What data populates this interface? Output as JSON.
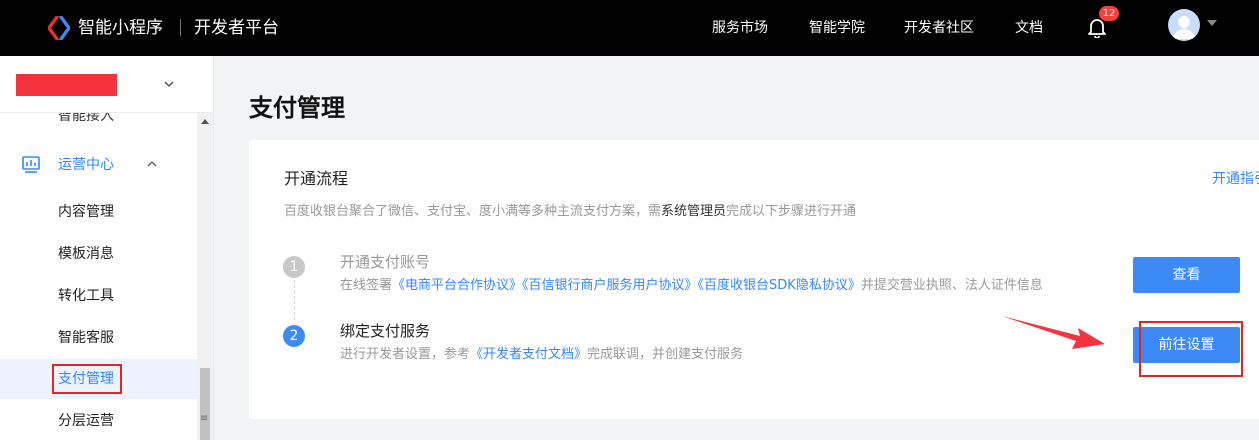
{
  "header": {
    "brand": "智能小程序",
    "sub_brand": "开发者平台",
    "nav": [
      "服务市场",
      "智能学院",
      "开发者社区",
      "文档"
    ],
    "notification_count": "12"
  },
  "sidebar": {
    "cut_item": "智能接入",
    "group": {
      "label": "运营中心"
    },
    "items": [
      {
        "label": "内容管理"
      },
      {
        "label": "模板消息"
      },
      {
        "label": "转化工具"
      },
      {
        "label": "智能客服"
      },
      {
        "label": "支付管理"
      },
      {
        "label": "分层运营"
      }
    ],
    "scroll_grip": "≡"
  },
  "main": {
    "title": "支付管理",
    "card": {
      "title": "开通流程",
      "guide_link": "开通指引",
      "desc_before": "百度收银台聚合了微信、支付宝、度小满等多种主流支付方案，需",
      "desc_role": "系统管理员",
      "desc_after": "完成以下步骤进行开通",
      "steps": [
        {
          "num": "1",
          "title": "开通支付账号",
          "desc_prefix": "在线签署",
          "links": [
            "《电商平台合作协议》",
            "《百信银行商户服务用户协议》",
            "《百度收银台SDK隐私协议》"
          ],
          "desc_suffix": "并提交营业执照、法人证件信息",
          "button": "查看"
        },
        {
          "num": "2",
          "title": "绑定支付服务",
          "desc_prefix": "进行开发者设置，参考",
          "links": [
            "《开发者支付文档》"
          ],
          "desc_suffix": "完成联调，并创建支付服务",
          "button": "前往设置"
        }
      ]
    }
  },
  "colors": {
    "accent": "#3388ff",
    "button": "#3c8bf5",
    "annotation": "#e02727",
    "topbar": "#000000"
  }
}
